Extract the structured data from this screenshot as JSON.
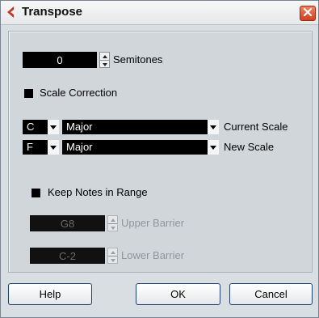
{
  "window": {
    "title": "Transpose",
    "close_label": "✕"
  },
  "semitones": {
    "value": "0",
    "label": "Semitones"
  },
  "scale_correction": {
    "label": "Scale Correction",
    "checked": true
  },
  "current_scale": {
    "root": "C",
    "scale": "Major",
    "label": "Current Scale"
  },
  "new_scale": {
    "root": "F",
    "scale": "Major",
    "label": "New Scale"
  },
  "keep_in_range": {
    "label": "Keep Notes in Range",
    "checked": true
  },
  "upper_barrier": {
    "value": "G8",
    "label": "Upper Barrier"
  },
  "lower_barrier": {
    "value": "C-2",
    "label": "Lower Barrier"
  },
  "buttons": {
    "help": "Help",
    "ok": "OK",
    "cancel": "Cancel"
  },
  "colors": {
    "accent": "#c0392b",
    "panel": "#d1d6da",
    "field": "#000000"
  }
}
